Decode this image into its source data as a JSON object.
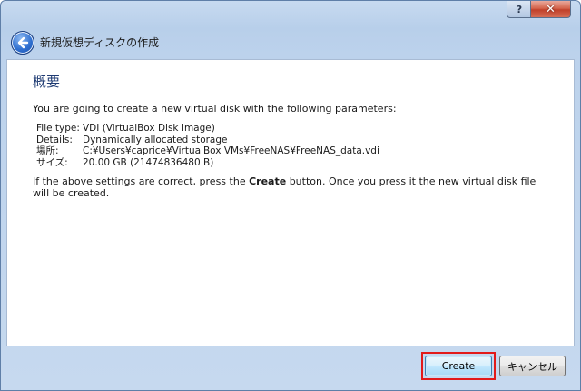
{
  "window": {
    "title": "新規仮想ディスクの作成",
    "help_glyph": "?",
    "close_glyph": "✕"
  },
  "page": {
    "heading": "概要",
    "intro": "You are going to create a new virtual disk with the following parameters:",
    "params": [
      {
        "key": "File type:",
        "value": "VDI (VirtualBox Disk Image)"
      },
      {
        "key": "Details:",
        "value": "Dynamically allocated storage"
      },
      {
        "key": "場所:",
        "value": "C:¥Users¥caprice¥VirtualBox VMs¥FreeNAS¥FreeNAS_data.vdi"
      },
      {
        "key": "サイズ:",
        "value": "20.00 GB (21474836480 B)"
      }
    ],
    "confirm_before": "If the above settings are correct, press the ",
    "confirm_bold": "Create",
    "confirm_after": " button. Once you press it the new virtual disk file will be created."
  },
  "buttons": {
    "create": "Create",
    "cancel": "キャンセル"
  },
  "colors": {
    "heading": "#1f3b73",
    "highlight": "#e21a1a"
  }
}
